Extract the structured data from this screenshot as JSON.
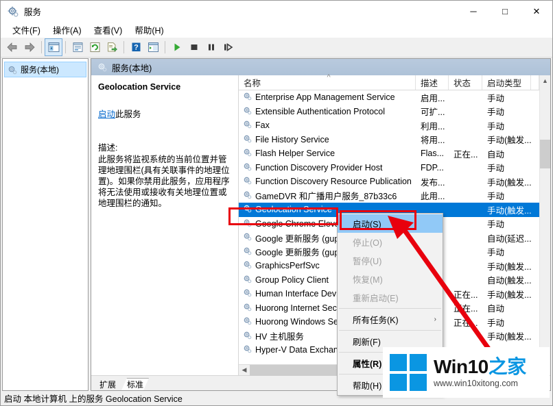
{
  "window": {
    "title": "服务",
    "icon": "services-gear-icon",
    "minimize_label": "─",
    "maximize_label": "□",
    "close_label": "✕"
  },
  "menubar": [
    {
      "label": "文件(F)",
      "name": "menu-file"
    },
    {
      "label": "操作(A)",
      "name": "menu-action"
    },
    {
      "label": "查看(V)",
      "name": "menu-view"
    },
    {
      "label": "帮助(H)",
      "name": "menu-help"
    }
  ],
  "toolbar": [
    {
      "name": "back-arrow-icon",
      "glyph": "back"
    },
    {
      "name": "forward-arrow-icon",
      "glyph": "forward"
    },
    {
      "name": "show-hide-console-tree-icon",
      "glyph": "tree"
    },
    {
      "name": "properties-icon",
      "glyph": "props"
    },
    {
      "name": "refresh-icon",
      "glyph": "refresh"
    },
    {
      "name": "export-list-icon",
      "glyph": "export"
    },
    {
      "name": "help-icon",
      "glyph": "help"
    },
    {
      "name": "list-view-icon",
      "glyph": "listview"
    },
    {
      "name": "start-service-icon",
      "glyph": "play"
    },
    {
      "name": "stop-service-icon",
      "glyph": "stop"
    },
    {
      "name": "pause-service-icon",
      "glyph": "pause"
    },
    {
      "name": "restart-service-icon",
      "glyph": "restart"
    }
  ],
  "tree": {
    "root_label": "服务(本地)"
  },
  "right_pane": {
    "header_label": "服务(本地)"
  },
  "details": {
    "service_name": "Geolocation Service",
    "action_link": "启动",
    "action_suffix": "此服务",
    "description_label": "描述:",
    "description_text": "此服务将监视系统的当前位置并管理地理围栏(具有关联事件的地理位置)。如果你禁用此服务，应用程序将无法使用或接收有关地理位置或地理围栏的通知。"
  },
  "columns": [
    {
      "label": "名称",
      "name": "column-name",
      "sorted": true
    },
    {
      "label": "描述",
      "name": "column-description",
      "sorted": false
    },
    {
      "label": "状态",
      "name": "column-status",
      "sorted": false
    },
    {
      "label": "启动类型",
      "name": "column-startup-type",
      "sorted": false
    }
  ],
  "services": [
    {
      "name": "Enterprise App Management Service",
      "description": "启用...",
      "status": "",
      "startup": "手动",
      "selected": false
    },
    {
      "name": "Extensible Authentication Protocol",
      "description": "可扩...",
      "status": "",
      "startup": "手动",
      "selected": false
    },
    {
      "name": "Fax",
      "description": "利用...",
      "status": "",
      "startup": "手动",
      "selected": false
    },
    {
      "name": "File History Service",
      "description": "将用...",
      "status": "",
      "startup": "手动(触发...",
      "selected": false
    },
    {
      "name": "Flash Helper Service",
      "description": "Flas...",
      "status": "正在...",
      "startup": "自动",
      "selected": false
    },
    {
      "name": "Function Discovery Provider Host",
      "description": "FDP...",
      "status": "",
      "startup": "手动",
      "selected": false
    },
    {
      "name": "Function Discovery Resource Publication",
      "description": "发布...",
      "status": "",
      "startup": "手动(触发...",
      "selected": false
    },
    {
      "name": "GameDVR 和广播用户服务_87b33c6",
      "description": "此用...",
      "status": "",
      "startup": "手动",
      "selected": false
    },
    {
      "name": "Geolocation Service",
      "description": "",
      "status": "",
      "startup": "手动(触发...",
      "selected": true
    },
    {
      "name": "Google Chrome Elevat",
      "description": "",
      "status": "",
      "startup": "手动",
      "selected": false
    },
    {
      "name": "Google 更新服务 (gup",
      "description": "",
      "status": "",
      "startup": "自动(延迟...",
      "selected": false
    },
    {
      "name": "Google 更新服务 (gup",
      "description": "",
      "status": "",
      "startup": "手动",
      "selected": false
    },
    {
      "name": "GraphicsPerfSvc",
      "description": "",
      "status": "",
      "startup": "手动(触发...",
      "selected": false
    },
    {
      "name": "Group Policy Client",
      "description": "",
      "status": "",
      "startup": "自动(触发...",
      "selected": false
    },
    {
      "name": "Human Interface Devic",
      "description": "",
      "status": "正在...",
      "startup": "手动(触发...",
      "selected": false
    },
    {
      "name": "Huorong Internet Secu",
      "description": "",
      "status": "正在...",
      "startup": "自动",
      "selected": false
    },
    {
      "name": "Huorong Windows Se",
      "description": "",
      "status": "正在...",
      "startup": "手动",
      "selected": false
    },
    {
      "name": "HV 主机服务",
      "description": "",
      "status": "",
      "startup": "手动(触发...",
      "selected": false
    },
    {
      "name": "Hyper-V Data Exchang",
      "description": "",
      "status": "",
      "startup": "",
      "selected": false
    }
  ],
  "context_menu": [
    {
      "label": "启动(S)",
      "name": "context-menu-start",
      "state": "highlighted"
    },
    {
      "label": "停止(O)",
      "name": "context-menu-stop",
      "state": "disabled"
    },
    {
      "label": "暂停(U)",
      "name": "context-menu-pause",
      "state": "disabled"
    },
    {
      "label": "恢复(M)",
      "name": "context-menu-resume",
      "state": "disabled"
    },
    {
      "label": "重新启动(E)",
      "name": "context-menu-restart",
      "state": "disabled"
    },
    {
      "label": "separator",
      "name": "context-menu-separator-1",
      "state": "separator"
    },
    {
      "label": "所有任务(K)",
      "name": "context-menu-all-tasks",
      "state": "submenu"
    },
    {
      "label": "separator",
      "name": "context-menu-separator-2",
      "state": "separator"
    },
    {
      "label": "刷新(F)",
      "name": "context-menu-refresh",
      "state": "normal"
    },
    {
      "label": "separator",
      "name": "context-menu-separator-3",
      "state": "separator"
    },
    {
      "label": "属性(R)",
      "name": "context-menu-properties",
      "state": "bold"
    },
    {
      "label": "separator",
      "name": "context-menu-separator-4",
      "state": "separator"
    },
    {
      "label": "帮助(H)",
      "name": "context-menu-help",
      "state": "normal"
    }
  ],
  "tabs": [
    {
      "label": "扩展",
      "name": "tab-extended",
      "active": false
    },
    {
      "label": "标准",
      "name": "tab-standard",
      "active": true
    }
  ],
  "statusbar": {
    "text": "启动 本地计算机 上的服务 Geolocation Service"
  },
  "watermark": {
    "brand_black": "Win10",
    "brand_blue": "之家",
    "url": "www.win10xitong.com"
  },
  "colors": {
    "selection_blue": "#0078d7",
    "annotation_red": "#e8000d",
    "link_blue": "#0066cc",
    "menu_highlight": "#91c9f7",
    "watermark_blue": "#0a96e2",
    "header_blue": "#b5c7de"
  }
}
